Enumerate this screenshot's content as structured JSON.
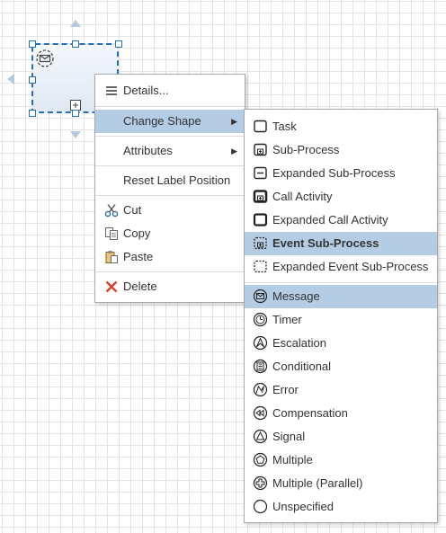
{
  "context_menu": {
    "items": {
      "details": "Details...",
      "change_shape": "Change Shape",
      "attributes": "Attributes",
      "reset_label": "Reset Label Position",
      "cut": "Cut",
      "copy": "Copy",
      "paste": "Paste",
      "delete": "Delete"
    },
    "submenu_arrow": "▶"
  },
  "change_shape_menu": {
    "items": [
      {
        "label": "Task",
        "icon": "task-icon"
      },
      {
        "label": "Sub-Process",
        "icon": "sub-process-icon"
      },
      {
        "label": "Expanded Sub-Process",
        "icon": "expanded-sub-process-icon"
      },
      {
        "label": "Call Activity",
        "icon": "call-activity-icon"
      },
      {
        "label": "Expanded Call Activity",
        "icon": "expanded-call-activity-icon"
      },
      {
        "label": "Event Sub-Process",
        "icon": "event-sub-process-icon",
        "selected": true
      },
      {
        "label": "Expanded Event Sub-Process",
        "icon": "expanded-event-sub-process-icon"
      },
      {
        "label": "Message",
        "icon": "message-icon",
        "selected": true
      },
      {
        "label": "Timer",
        "icon": "timer-icon"
      },
      {
        "label": "Escalation",
        "icon": "escalation-icon"
      },
      {
        "label": "Conditional",
        "icon": "conditional-icon"
      },
      {
        "label": "Error",
        "icon": "error-icon"
      },
      {
        "label": "Compensation",
        "icon": "compensation-icon"
      },
      {
        "label": "Signal",
        "icon": "signal-icon"
      },
      {
        "label": "Multiple",
        "icon": "multiple-icon"
      },
      {
        "label": "Multiple (Parallel)",
        "icon": "multiple-parallel-icon"
      },
      {
        "label": "Unspecified",
        "icon": "unspecified-icon"
      }
    ]
  },
  "colors": {
    "highlight": "#b4cce4",
    "selection": "#2a6fb5",
    "delete_icon": "#d9442c",
    "cut_icon": "#3a6ea5"
  }
}
